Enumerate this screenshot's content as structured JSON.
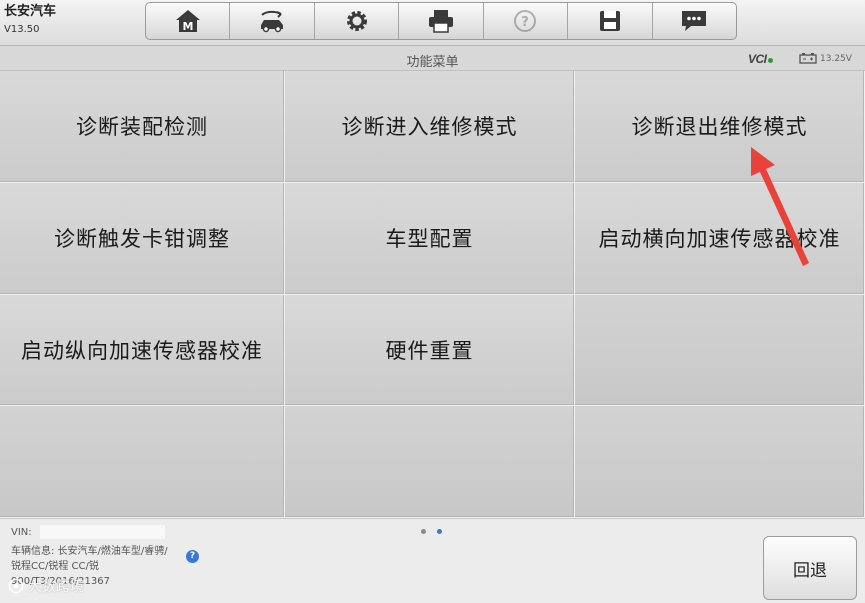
{
  "app": {
    "name": "长安汽车",
    "version": "V13.50"
  },
  "toolbar": [
    {
      "icon": "home-m-icon",
      "enabled": true
    },
    {
      "icon": "car-swap-icon",
      "enabled": true
    },
    {
      "icon": "gear-icon",
      "enabled": true
    },
    {
      "icon": "printer-icon",
      "enabled": true
    },
    {
      "icon": "help-icon",
      "enabled": false
    },
    {
      "icon": "save-icon",
      "enabled": true
    },
    {
      "icon": "message-icon",
      "enabled": true
    }
  ],
  "subheader": {
    "title": "功能菜单",
    "vci_label": "VCI",
    "voltage": "13.25V"
  },
  "menu": {
    "items": [
      "诊断装配检测",
      "诊断进入维修模式",
      "诊断退出维修模式",
      "诊断触发卡钳调整",
      "车型配置",
      "启动横向加速传感器校准",
      "启动纵向加速传感器校准",
      "硬件重置"
    ]
  },
  "footer": {
    "vin_label": "VIN:",
    "vehicle_info": "车辆信息: 长安汽车/燃油车型/睿骋/锐程CC/锐程 CC/锐",
    "vehicle_info_tail": "900/T3/2016/21367",
    "back_label": "回退",
    "watermark": "大数跨境",
    "page_count": 2,
    "active_page": 2
  },
  "colors": {
    "accent": "#3a78d8",
    "annotation_arrow": "#e8423b"
  }
}
